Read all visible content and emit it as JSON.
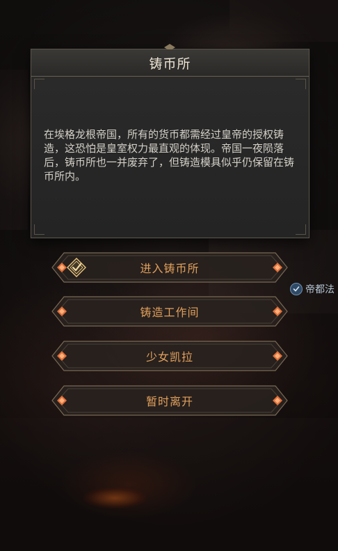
{
  "dialog": {
    "title": "铸币所",
    "body": "在埃格龙根帝国，所有的货币都需经过皇帝的授权铸造，这恐怕是皇室权力最直观的体现。帝国一夜陨落后，铸币所也一并废弃了，但铸造模具似乎仍保留在铸币所内。"
  },
  "choices": [
    {
      "label": "进入铸币所",
      "selected": true,
      "icon": "check-emblem-icon"
    },
    {
      "label": "铸造工作间",
      "selected": false
    },
    {
      "label": "少女凯拉",
      "selected": false
    },
    {
      "label": "暂时离开",
      "selected": false
    }
  ],
  "side_tag": {
    "label": "帝都法",
    "icon": "check-circle-icon"
  },
  "colors": {
    "choice_text": "#e2a05c",
    "gem": "#e0703a",
    "panel_bg": "#282828",
    "title_text": "#ece4d4"
  }
}
